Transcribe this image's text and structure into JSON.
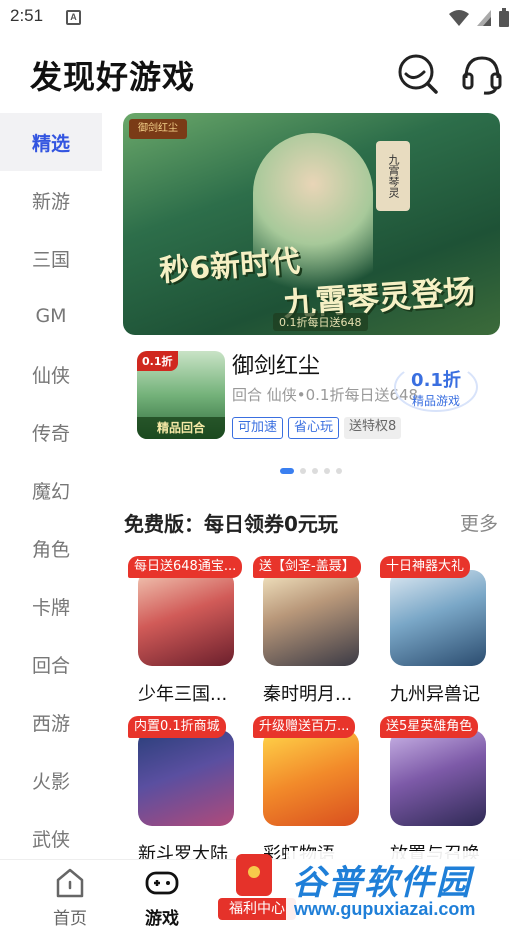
{
  "status_bar": {
    "time": "2:51",
    "icon_letter": "A"
  },
  "header": {
    "title": "发现好游戏",
    "icons": [
      "search-icon",
      "headset-icon"
    ]
  },
  "sidebar": {
    "items": [
      {
        "label": "精选",
        "active": true
      },
      {
        "label": "新游"
      },
      {
        "label": "三国"
      },
      {
        "label": "GM"
      },
      {
        "label": "仙侠"
      },
      {
        "label": "传奇"
      },
      {
        "label": "魔幻"
      },
      {
        "label": "角色"
      },
      {
        "label": "卡牌"
      },
      {
        "label": "回合"
      },
      {
        "label": "西游"
      },
      {
        "label": "火影"
      },
      {
        "label": "武侠"
      }
    ]
  },
  "banner": {
    "logo": "御剑红尘",
    "scroll_tag": "九霄琴灵",
    "headline_1": "秒6新时代",
    "headline_2": "九霄琴灵登场",
    "subtitle": "0.1折每日送648"
  },
  "featured": {
    "name": "御剑红尘",
    "desc": "回合 仙侠•0.1折每日送648",
    "icon_badge": "0.1折",
    "icon_strip": "精品回合",
    "tags": [
      "可加速",
      "省心玩",
      "送特权8"
    ],
    "discount_value": "0.1折",
    "discount_label": "精品游戏"
  },
  "carousel": {
    "count": 5,
    "active_index": 0
  },
  "section": {
    "title": "免费版：每日领券0元玩",
    "more": "更多",
    "games": [
      {
        "ribbon": "每日送648通宝...",
        "name": "少年三国..."
      },
      {
        "ribbon": "送【剑圣-盖聂】",
        "name": "秦时明月..."
      },
      {
        "ribbon": "十日神器大礼",
        "name": "九州异兽记"
      },
      {
        "ribbon": "内置0.1折商城",
        "name": "新斗罗大陆"
      },
      {
        "ribbon": "升级赠送百万...",
        "name": "彩虹物语"
      },
      {
        "ribbon": "送5星英雄角色",
        "name": "放置与召唤"
      }
    ]
  },
  "bottom_nav": {
    "items": [
      {
        "label": "首页",
        "active": false
      },
      {
        "label": "游戏",
        "active": true
      }
    ],
    "welfare": "福利中心"
  },
  "watermark": {
    "logo": "谷普软件园",
    "url": "www.gupuxiazai.com"
  },
  "colors": {
    "accent": "#3355e0",
    "ribbon": "#e8342b",
    "tag_blue": "#3a6fe0"
  }
}
